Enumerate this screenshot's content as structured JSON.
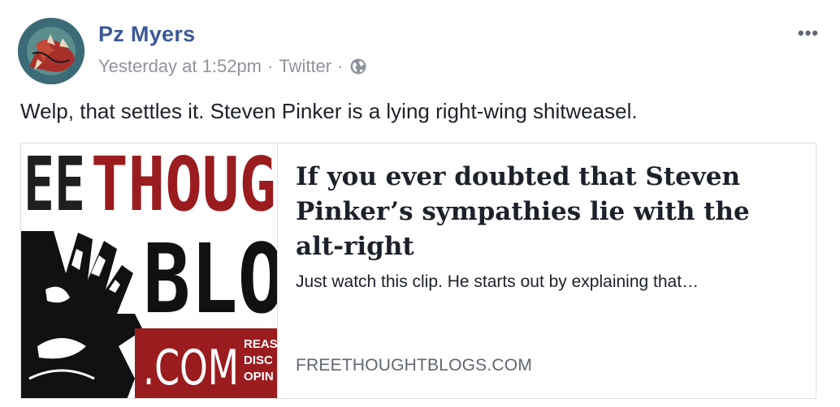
{
  "post": {
    "author": "Pz Myers",
    "timestamp": "Yesterday at 1:52pm",
    "separator": "·",
    "source": "Twitter",
    "privacy_icon": "globe-icon",
    "more_icon": "•••",
    "text": "Welp, that settles it. Steven Pinker is a lying right-wing shitweasel."
  },
  "link_card": {
    "title": "If you ever doubted that Steven Pinker’s sympathies lie with the alt-right",
    "description": "Just watch this clip. He starts out by explaining that…",
    "domain": "FREETHOUGHTBLOGS.COM",
    "logo": {
      "row1_black": "EE",
      "row1_red": "THOUG",
      "row2": "BLO",
      "dotcom": ".COM",
      "tagline": [
        "REAS",
        "DISC",
        "OPIN"
      ]
    }
  },
  "colors": {
    "author_blue": "#3b5998",
    "meta_gray": "#90949c",
    "logo_red": "#9b1c1f"
  }
}
